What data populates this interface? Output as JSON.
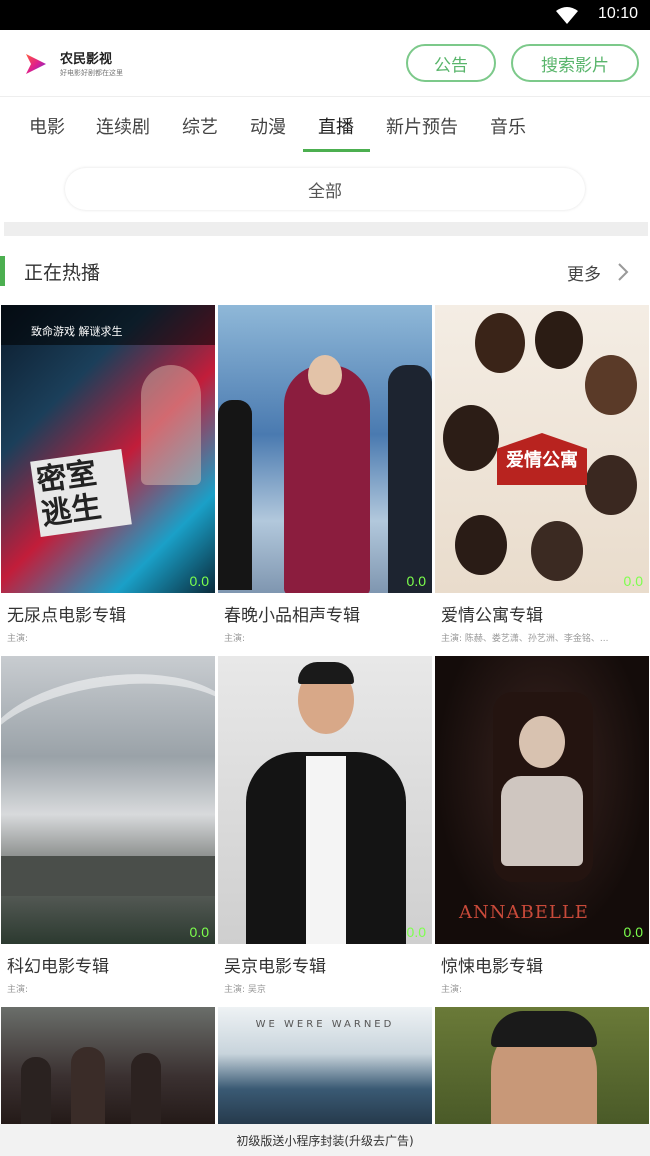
{
  "status_bar": {
    "time": "10:10"
  },
  "header": {
    "app_name": "农民影视",
    "app_sub": "好电影好剧都在这里",
    "notice_label": "公告",
    "search_label": "搜索影片"
  },
  "tabs": [
    "电影",
    "连续剧",
    "综艺",
    "动漫",
    "直播",
    "新片预告",
    "音乐"
  ],
  "active_tab": "直播",
  "filter": {
    "selected": "全部"
  },
  "section": {
    "title": "正在热播",
    "more_label": "更多"
  },
  "videos": [
    {
      "title": "无尿点电影专辑",
      "cast": "主演:",
      "score": "0.0"
    },
    {
      "title": "春晚小品相声专辑",
      "cast": "主演:",
      "score": "0.0"
    },
    {
      "title": "爱情公寓专辑",
      "cast": "主演: 陈赫、娄艺潇、孙艺洲、李金铭、...",
      "score": "0.0"
    },
    {
      "title": "科幻电影专辑",
      "cast": "主演:",
      "score": "0.0"
    },
    {
      "title": "吴京电影专辑",
      "cast": "主演: 吴京",
      "score": "0.0"
    },
    {
      "title": "惊悚电影专辑",
      "cast": "主演:",
      "score": "0.0"
    }
  ],
  "poster_texts": {
    "p1_top": "致命游戏 解谜求生",
    "p1_main": "密室逃生",
    "p3_main": "爱情公寓",
    "p6_main": "ANNABELLE",
    "p8_top": "WE WERE WARNED"
  },
  "banner": {
    "text": "初级版送小程序封装(升级去广告)"
  },
  "colors": {
    "accent": "#4caf50",
    "button_border": "#7cc98a",
    "score": "#7dff4d"
  }
}
